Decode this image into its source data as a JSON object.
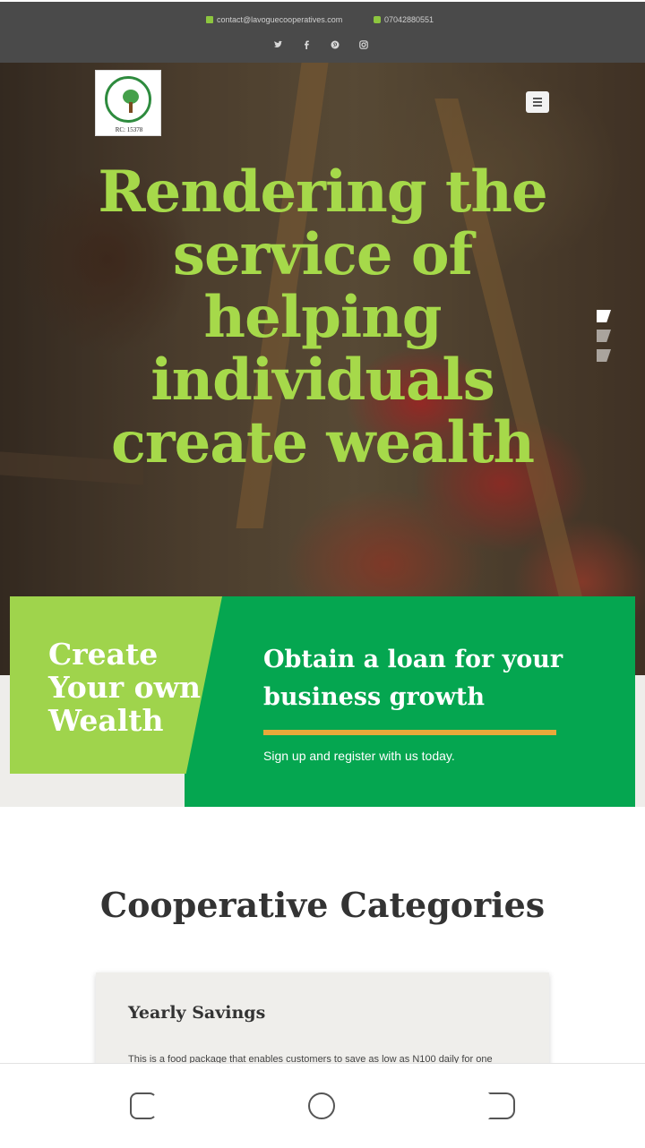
{
  "topbar": {
    "email": "contact@lavoguecooperatives.com",
    "phone": "07042880551",
    "social_icons": [
      "twitter-icon",
      "facebook-icon",
      "pinterest-icon",
      "instagram-icon"
    ]
  },
  "header": {
    "logo_rc": "RC: 15378",
    "menu_icon": "hamburger-icon"
  },
  "hero": {
    "title": "Rendering the service of helping individuals create wealth",
    "title_color": "#a6d94a",
    "slides": 3,
    "active_slide": 1
  },
  "promo": {
    "left_title": "Create Your own Wealth",
    "right_title": "Obtain a loan for your business growth",
    "subtitle": "Sign up and register with us today.",
    "lime_color": "#9fd44c",
    "green_color": "#05a650",
    "accent_color": "#e9a93a"
  },
  "categories": {
    "title": "Cooperative Categories",
    "cards": [
      {
        "title": "Yearly Savings",
        "text": "This is a food package that enables customers to save as low as N100 daily for one"
      }
    ]
  }
}
